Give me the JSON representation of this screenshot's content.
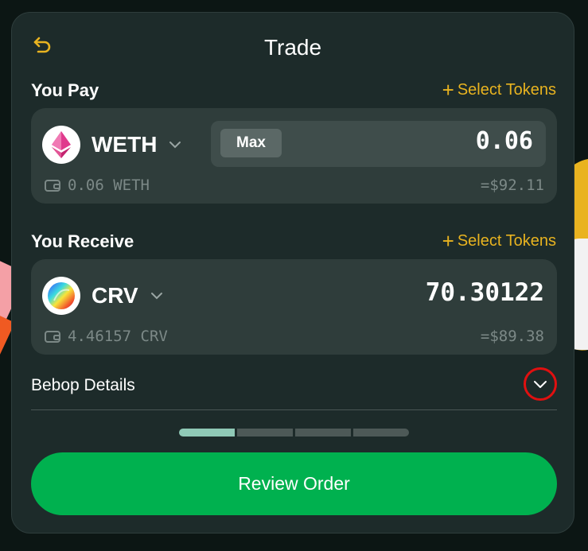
{
  "header": {
    "title": "Trade",
    "back_icon": "back-arrow-icon"
  },
  "pay": {
    "label": "You Pay",
    "select_tokens": "Select Tokens",
    "token": "WETH",
    "max_label": "Max",
    "amount": "0.06",
    "balance": "0.06 WETH",
    "usd_value": "=$92.11"
  },
  "receive": {
    "label": "You Receive",
    "select_tokens": "Select Tokens",
    "token": "CRV",
    "amount": "70.30122",
    "balance": "4.46157 CRV",
    "usd_value": "=$89.38"
  },
  "details": {
    "label": "Bebop Details"
  },
  "progress": {
    "steps": 4,
    "active": 1
  },
  "review_button": "Review Order",
  "colors": {
    "accent": "#e8b320",
    "primary": "#00b14f",
    "card": "#1d2b2a",
    "panel": "#2f3d3b"
  }
}
